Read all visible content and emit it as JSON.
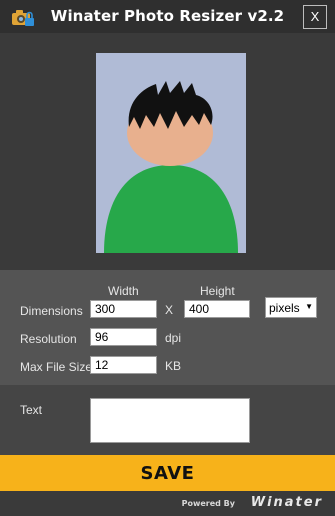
{
  "window": {
    "title": "Winater Photo Resizer v2.2",
    "close_label": "X",
    "app_icon": "camera-lock-icon"
  },
  "preview": {
    "background_color": "#b0bbd6",
    "shirt_color": "#27a84a",
    "face_color": "#e8b08e",
    "hair_color": "#111111"
  },
  "form": {
    "width_header": "Width",
    "height_header": "Height",
    "dimensions_label": "Dimensions",
    "width_value": "300",
    "times_label": "X",
    "height_value": "400",
    "unit_selected": "pixels",
    "resolution_label": "Resolution",
    "resolution_value": "96",
    "resolution_unit": "dpi",
    "max_file_size_label": "Max File Size",
    "max_file_size_value": "12",
    "max_file_size_unit": "KB",
    "text_label": "Text",
    "text_value": ""
  },
  "save_label": "SAVE",
  "footer": {
    "powered_by": "Powered By",
    "brand": "Winater"
  },
  "colors": {
    "accent": "#f7b21a",
    "panel": "#545454",
    "background": "#3a3a3a"
  }
}
